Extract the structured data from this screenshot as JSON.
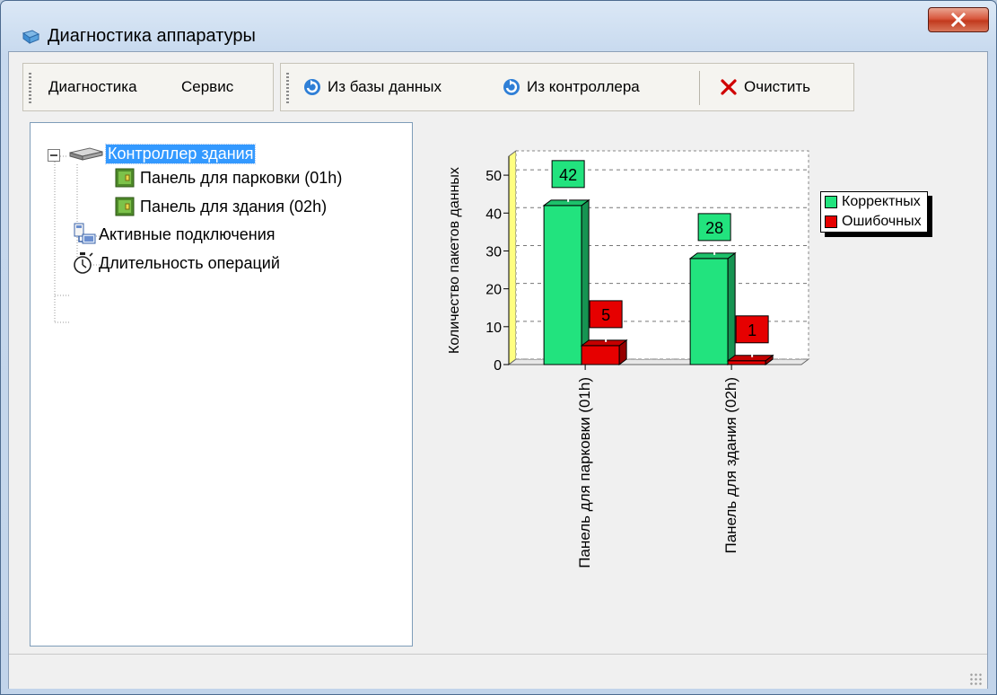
{
  "window": {
    "title": "Диагностика аппаратуры",
    "close_label": "x"
  },
  "menu": {
    "items": [
      "Диагностика",
      "Сервис"
    ]
  },
  "toolbar": {
    "from_db": "Из базы данных",
    "from_controller": "Из контроллера",
    "clear": "Очистить"
  },
  "tree": {
    "root": "Контроллер здания",
    "children": [
      "Панель для парковки (01h)",
      "Панель для здания (02h)"
    ],
    "active": "Активные подключения",
    "duration": "Длительность операций"
  },
  "chart_data": {
    "type": "bar",
    "categories": [
      "Панель для парковки (01h)",
      "Панель для здания (02h)"
    ],
    "series": [
      {
        "name": "Корректных",
        "values": [
          42,
          28
        ],
        "color": "#22e37e"
      },
      {
        "name": "Ошибочных",
        "values": [
          5,
          1
        ],
        "color": "#e60000"
      }
    ],
    "ylabel": "Количество пакетов данных",
    "ylim": [
      0,
      55
    ],
    "yticks": [
      0,
      10,
      20,
      30,
      40,
      50
    ],
    "grid": true,
    "legend_position": "right"
  }
}
